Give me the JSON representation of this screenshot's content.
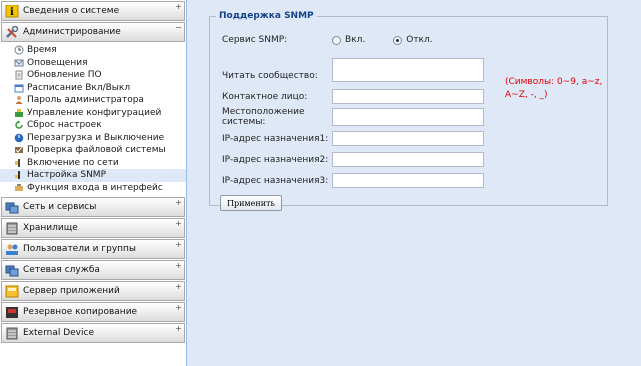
{
  "sidebar": {
    "categories": [
      {
        "label": "Сведения о системе",
        "icon": "info-icon",
        "color": "#f2c500"
      },
      {
        "label": "Администрирование",
        "icon": "tools-icon",
        "color": "#6a8fb8"
      },
      {
        "label": "Сеть и сервисы",
        "icon": "network-icon",
        "color": "#4a7ec2"
      },
      {
        "label": "Хранилище",
        "icon": "storage-icon",
        "color": "#8a8a8a"
      },
      {
        "label": "Пользователи и группы",
        "icon": "users-icon",
        "color": "#3b7fd1"
      },
      {
        "label": "Сетевая служба",
        "icon": "network-service-icon",
        "color": "#4a7ec2"
      },
      {
        "label": "Сервер приложений",
        "icon": "app-server-icon",
        "color": "#f0a800"
      },
      {
        "label": "Резервное копирование",
        "icon": "backup-icon",
        "color": "#444444"
      },
      {
        "label": "External Device",
        "icon": "external-device-icon",
        "color": "#8a8a8a"
      }
    ],
    "admin_items": [
      {
        "label": "Время",
        "icon": "clock-icon"
      },
      {
        "label": "Оповещения",
        "icon": "notification-icon"
      },
      {
        "label": "Обновление ПО",
        "icon": "firmware-update-icon"
      },
      {
        "label": "Расписание Вкл/Выкл",
        "icon": "schedule-icon"
      },
      {
        "label": "Пароль администратора",
        "icon": "password-icon"
      },
      {
        "label": "Управление конфигурацией",
        "icon": "config-icon"
      },
      {
        "label": "Сброс настроек",
        "icon": "reset-icon"
      },
      {
        "label": "Перезагрузка и Выключение",
        "icon": "power-icon"
      },
      {
        "label": "Проверка файловой системы",
        "icon": "filesystem-check-icon"
      },
      {
        "label": "Включение по сети",
        "icon": "wake-on-lan-icon"
      },
      {
        "label": "Настройка SNMP",
        "icon": "snmp-icon",
        "selected": true
      },
      {
        "label": "Функция входа в интерфейс",
        "icon": "login-icon"
      }
    ],
    "tool_symbol": "+",
    "tool_symbol_open": "−"
  },
  "snmp": {
    "legend": "Поддержка SNMP",
    "service_label": "Сервис SNMP:",
    "on_label": "Вкл.",
    "off_label": "Откл.",
    "service_enabled": false,
    "community_label": "Читать сообщество:",
    "community_value": "",
    "community_hint": "(Символы: 0~9, a~z, A~Z, -, _)",
    "contact_label": "Контактное лицо:",
    "contact_value": "",
    "location_label": "Местоположение системы:",
    "location_value": "",
    "trap1_label": "IP-адрес назначения1:",
    "trap1_value": "",
    "trap2_label": "IP-адрес назначения2:",
    "trap2_value": "",
    "trap3_label": "IP-адрес назначения3:",
    "trap3_value": "",
    "apply_label": "Применить"
  }
}
